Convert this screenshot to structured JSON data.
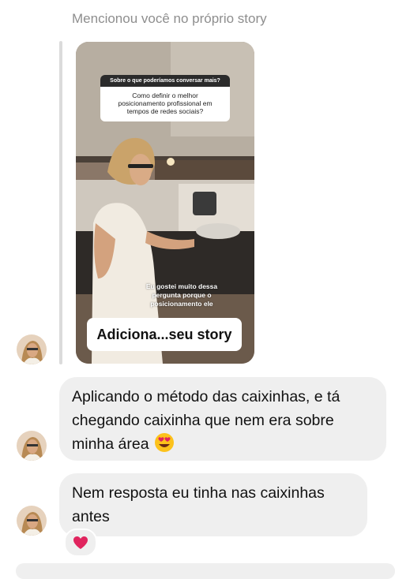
{
  "header": {
    "mention_text": "Mencionou você no próprio story"
  },
  "story": {
    "question_title": "Sobre o que poderíamos conversar mais?",
    "question_text": "Como definir o melhor posicionamento profissional em tempos de redes sociais?",
    "caption": "Eu gostei muito dessa pergunta porque o posicionamento ele",
    "add_to_story_label": "Adiciona...seu story"
  },
  "messages": [
    {
      "text": "Aplicando o método das caixinhas, e tá chegando caixinha que nem era sobre minha área",
      "emoji": "heart-eyes-emoji"
    },
    {
      "text": "Nem resposta eu tinha nas caixinhas antes",
      "reaction": "red-heart-emoji"
    }
  ],
  "colors": {
    "bubble_bg": "#efefef",
    "muted_text": "#8e8e8e",
    "heart": "#e0245e"
  }
}
